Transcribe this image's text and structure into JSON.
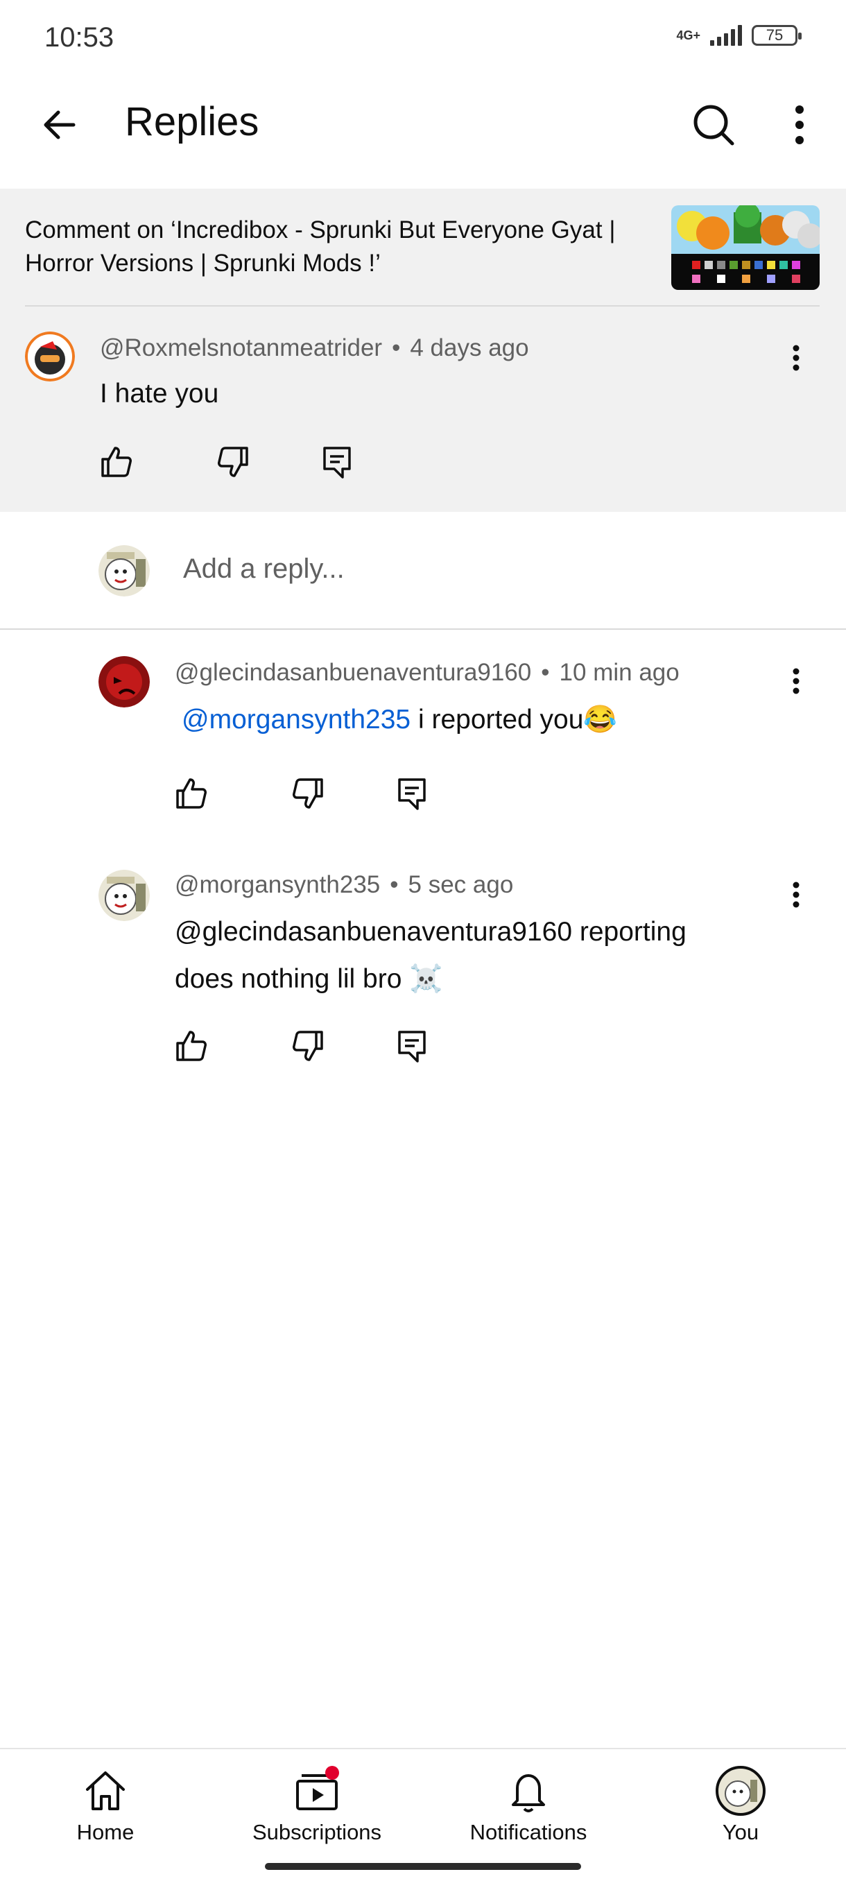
{
  "status_bar": {
    "time": "10:53",
    "network": "4G+",
    "battery": "75"
  },
  "header": {
    "title": "Replies",
    "back_icon": "arrow-left-icon",
    "search_icon": "search-icon",
    "more_icon": "more-vert-icon"
  },
  "parent": {
    "video_caption": "Comment on ‘Incredibox - Sprunki But Everyone Gyat | Horror Versions | Sprunki Mods !’",
    "author": "@Roxmelsnotanmeatrider",
    "time": "4 days ago",
    "text": "I hate you"
  },
  "reply_input": {
    "placeholder": "Add a reply..."
  },
  "replies": [
    {
      "author": "@glecindasanbuenaventura9160",
      "time": "10 min ago",
      "mention": "@morgansynth235",
      "text": " i reported you😂"
    },
    {
      "author": "@morgansynth235",
      "time": "5 sec ago",
      "text_line1": "@glecindasanbuenaventura9160  reporting",
      "text_line2": "does nothing lil bro ☠️"
    }
  ],
  "bottom_nav": {
    "home": "Home",
    "subscriptions": "Subscriptions",
    "notifications": "Notifications",
    "you": "You"
  },
  "colors": {
    "accent_link": "#065fd4",
    "badge_red": "#e1002d",
    "highlight_bg": "#f1f1f1"
  }
}
